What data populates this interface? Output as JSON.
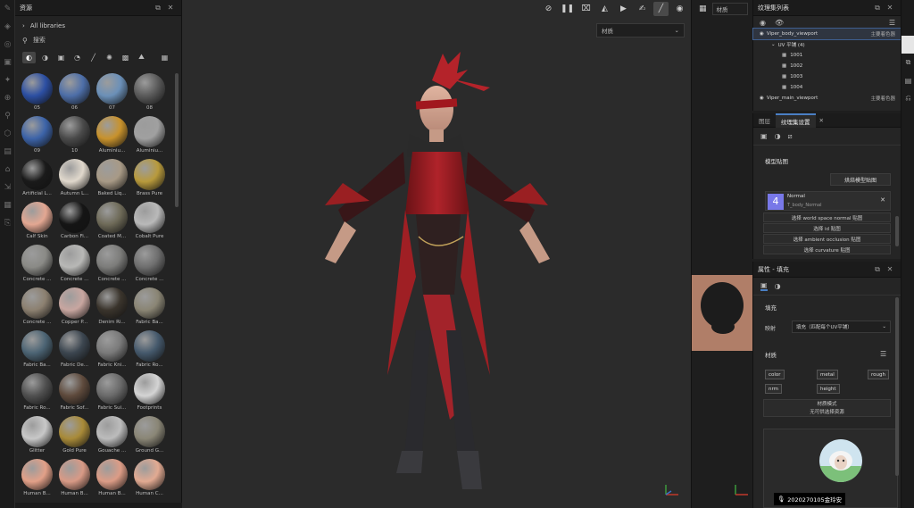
{
  "assets_panel": {
    "title": "资源",
    "breadcrumb": "All libraries",
    "search_placeholder": "搜索",
    "materials": [
      {
        "label": "05",
        "color": "#2c4fa3"
      },
      {
        "label": "06",
        "color": "#4d6ea8"
      },
      {
        "label": "07",
        "color": "#6b90b8"
      },
      {
        "label": "08",
        "color": "#5a5a5a"
      },
      {
        "label": "09",
        "color": "#3c63a8"
      },
      {
        "label": "10",
        "color": "#4a4a4a"
      },
      {
        "label": "Aluminiu...",
        "color": "#c8922c"
      },
      {
        "label": "Aluminiu...",
        "color": "#a0a0a0"
      },
      {
        "label": "Artificial L...",
        "color": "#1a1a1a"
      },
      {
        "label": "Autumn L...",
        "color": "#e0d8cc"
      },
      {
        "label": "Baked Liq...",
        "color": "#a89a86"
      },
      {
        "label": "Brass Pure",
        "color": "#b89a3c"
      },
      {
        "label": "Calf Skin",
        "color": "#e3a792"
      },
      {
        "label": "Carbon Fi...",
        "color": "#151515"
      },
      {
        "label": "Coated M...",
        "color": "#6e6a58"
      },
      {
        "label": "Cobalt Pure",
        "color": "#b9b9b9"
      },
      {
        "label": "Concrete ...",
        "color": "#8a8a86"
      },
      {
        "label": "Concrete ...",
        "color": "#b8b8b6"
      },
      {
        "label": "Concrete ...",
        "color": "#7c7c7a"
      },
      {
        "label": "Concrete ...",
        "color": "#6e6e6e"
      },
      {
        "label": "Concrete ...",
        "color": "#8c8070"
      },
      {
        "label": "Copper P...",
        "color": "#c8a6a0"
      },
      {
        "label": "Denim Ri...",
        "color": "#3a342c"
      },
      {
        "label": "Fabric Ba...",
        "color": "#8a8574"
      },
      {
        "label": "Fabric Ba...",
        "color": "#4c6474"
      },
      {
        "label": "Fabric De...",
        "color": "#3c4650"
      },
      {
        "label": "Fabric Kni...",
        "color": "#7a7a7a"
      },
      {
        "label": "Fabric Ro...",
        "color": "#45596c"
      },
      {
        "label": "Fabric Ro...",
        "color": "#505050"
      },
      {
        "label": "Fabric Sof...",
        "color": "#5e4a3c"
      },
      {
        "label": "Fabric Sui...",
        "color": "#6a6a6a"
      },
      {
        "label": "Footprints",
        "color": "#d4d4d4"
      },
      {
        "label": "Glitter",
        "color": "#c8c8c8"
      },
      {
        "label": "Gold Pure",
        "color": "#a88a38"
      },
      {
        "label": "Gouache ...",
        "color": "#bcbcbc"
      },
      {
        "label": "Ground G...",
        "color": "#8a8676"
      },
      {
        "label": "Human B...",
        "color": "#e2a088"
      },
      {
        "label": "Human B...",
        "color": "#d89a86"
      },
      {
        "label": "Human B...",
        "color": "#dc9c86"
      },
      {
        "label": "Human C...",
        "color": "#e2aa92"
      }
    ]
  },
  "viewport": {
    "material_dropdown": "材质"
  },
  "column3": {
    "material_dropdown": "材质"
  },
  "texture_sets": {
    "title": "纹理集列表",
    "rows": [
      {
        "name": "Viper_body_viewport",
        "tag": "主要着色器"
      },
      {
        "name": "UV 平铺 (4)",
        "tag": ""
      },
      {
        "name": "1001",
        "tag": ""
      },
      {
        "name": "1002",
        "tag": ""
      },
      {
        "name": "1003",
        "tag": ""
      },
      {
        "name": "1004",
        "tag": ""
      },
      {
        "name": "Viper_main_viewport",
        "tag": "主要着色器"
      }
    ]
  },
  "texture_set_settings": {
    "tab_layers": "图层",
    "tab_settings": "纹理集设置",
    "section": "模型贴图",
    "bake_button": "烘焙模型贴图",
    "normal_label": "Normal",
    "normal_map": "T_body_Normal",
    "normal_glyph": "4",
    "select_buttons": [
      "选择 world space normal 贴图",
      "选择 id 贴图",
      "选择 ambient occlusion 贴图",
      "选择 curvature 贴图"
    ]
  },
  "properties": {
    "title": "属性 - 填充",
    "fill_section": "填充",
    "mapping_label": "映射",
    "mapping_value": "填充（匹配每个UV平铺）",
    "material_section": "材质",
    "channels": [
      "color",
      "metal",
      "rough",
      "nrm",
      "height"
    ],
    "mode_title": "材质模式",
    "mode_value": "无可供选择资源",
    "watermark": "2020270105金玲安"
  }
}
